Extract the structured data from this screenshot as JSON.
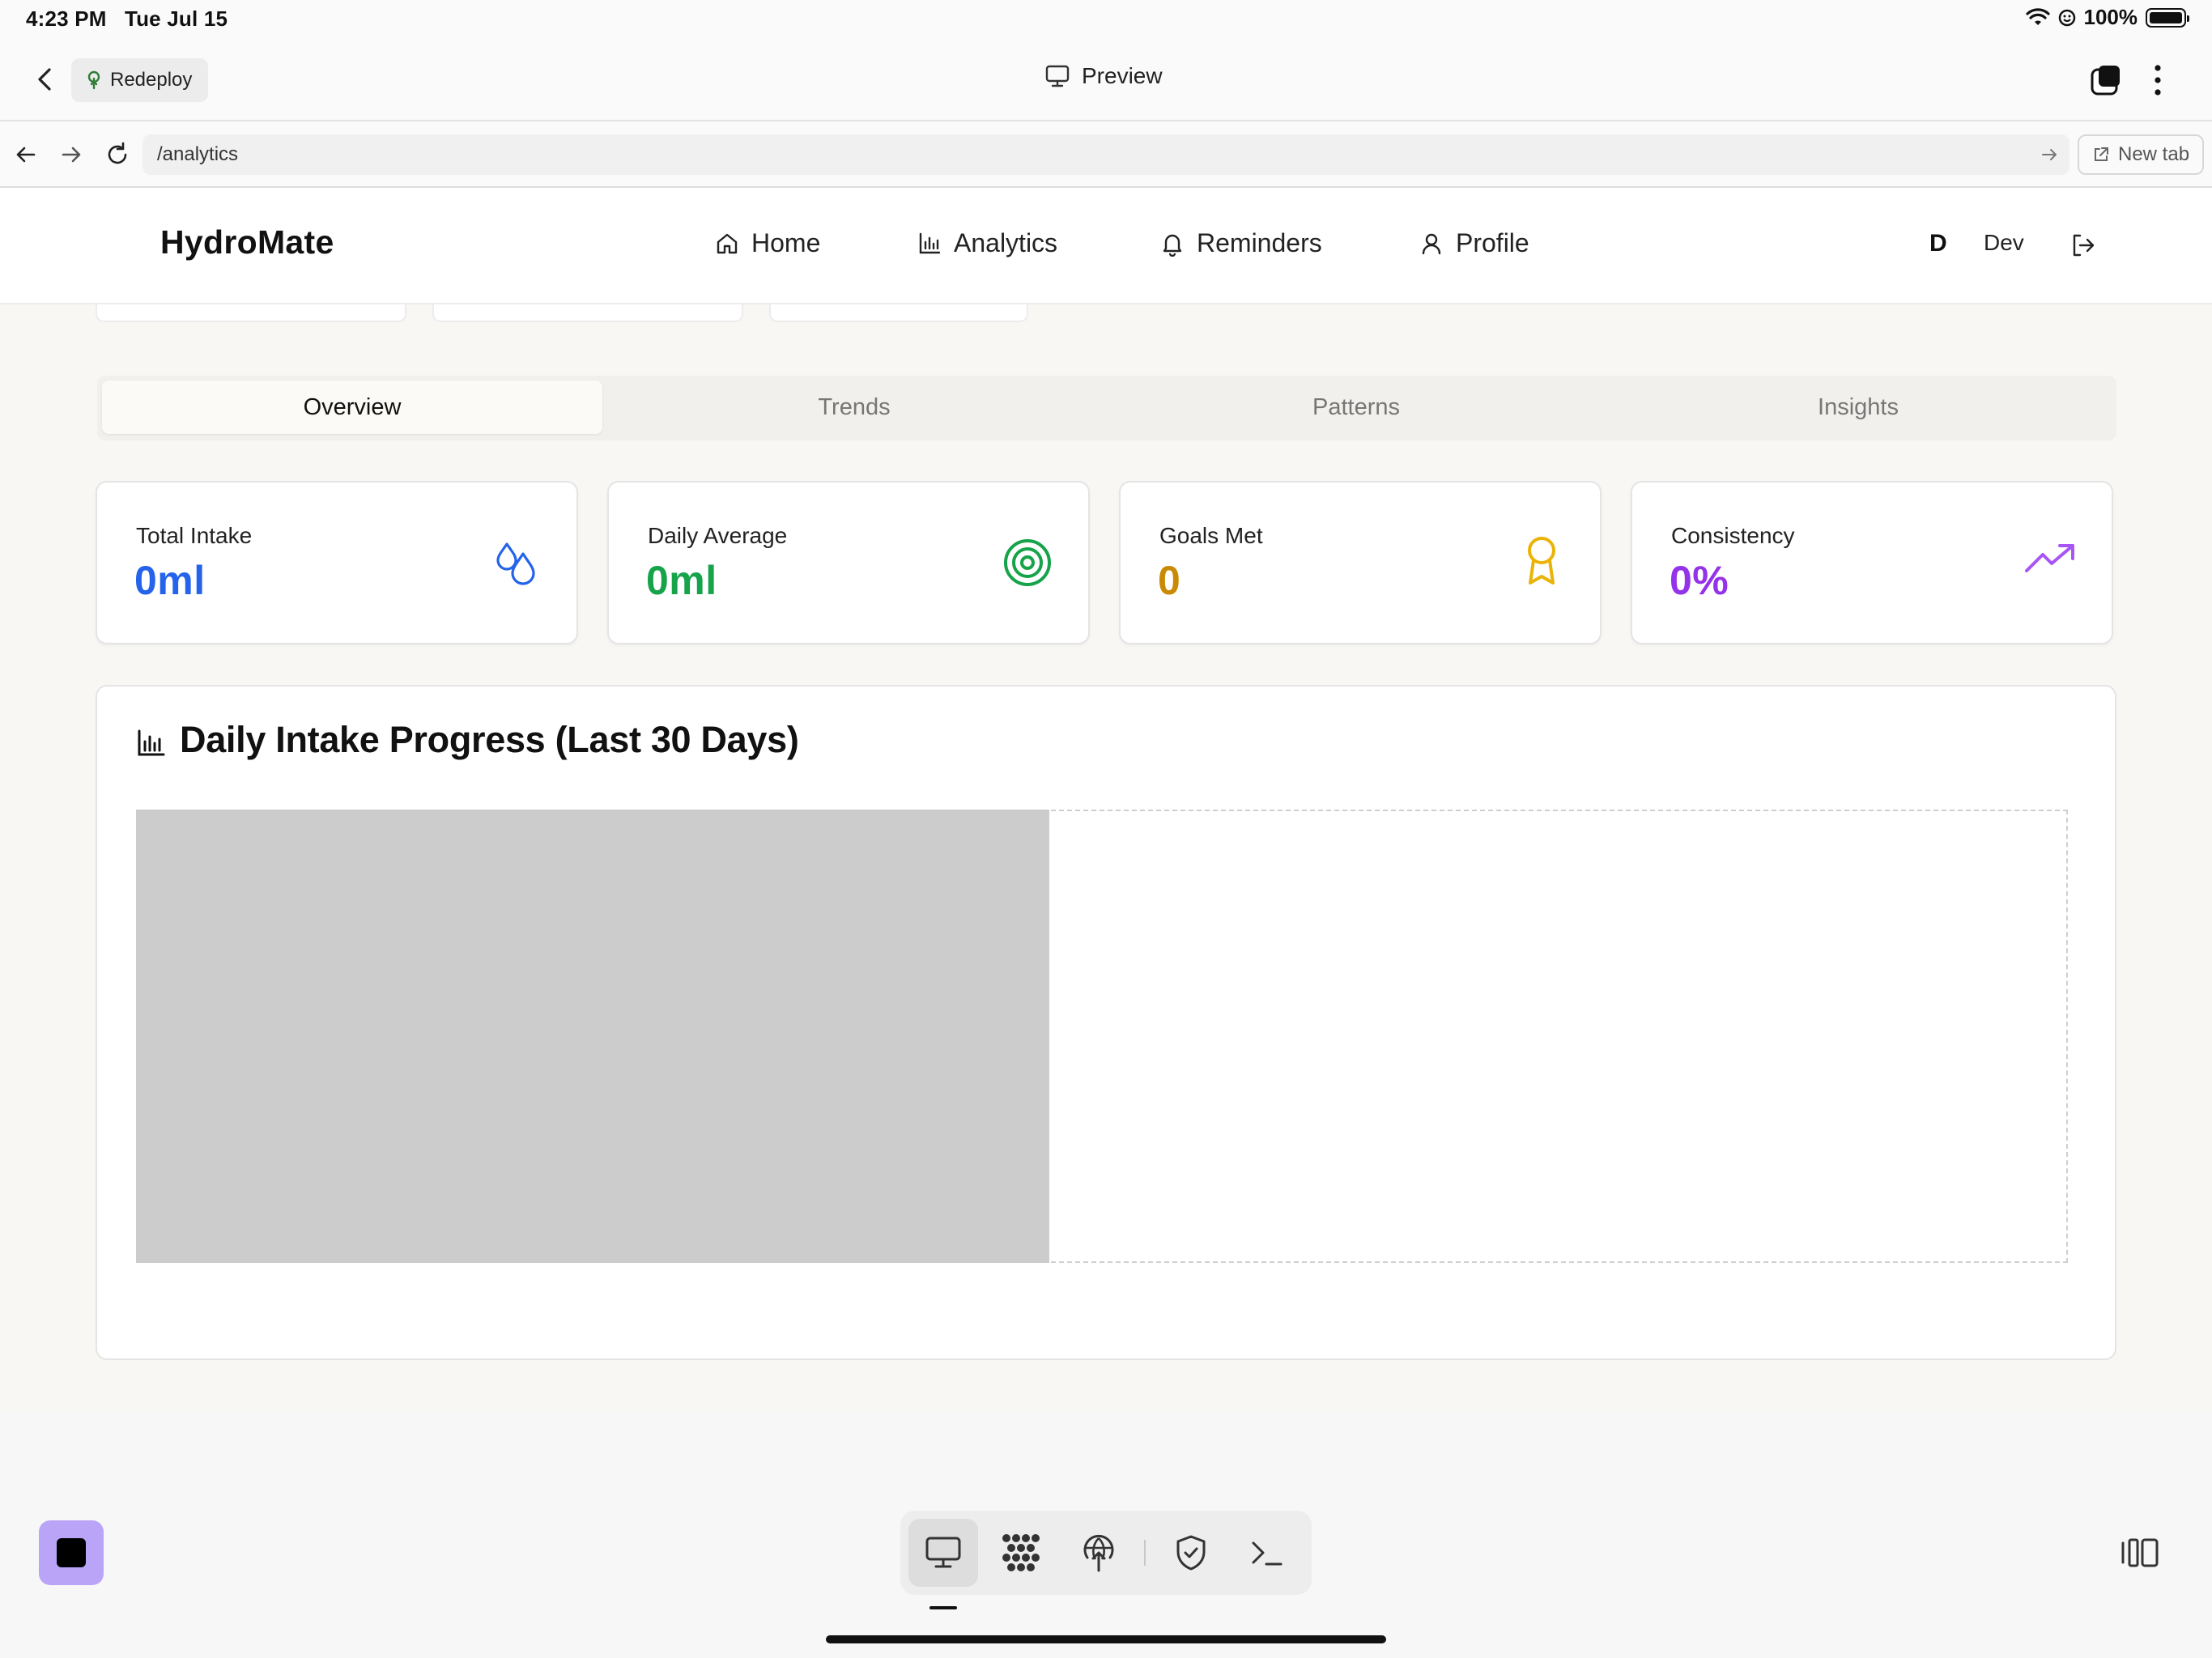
{
  "status_bar": {
    "time": "4:23 PM",
    "date": "Tue Jul 15",
    "battery": "100%"
  },
  "app_bar": {
    "redeploy_label": "Redeploy",
    "title": "Preview"
  },
  "url_bar": {
    "url": "/analytics",
    "new_tab_label": "New tab"
  },
  "site": {
    "brand": "HydroMate",
    "nav": [
      {
        "label": "Home",
        "icon": "home-icon"
      },
      {
        "label": "Analytics",
        "icon": "bar-chart-icon"
      },
      {
        "label": "Reminders",
        "icon": "bell-icon"
      },
      {
        "label": "Profile",
        "icon": "user-icon"
      }
    ],
    "user": {
      "initial": "D",
      "name": "Dev"
    }
  },
  "tabs": [
    "Overview",
    "Trends",
    "Patterns",
    "Insights"
  ],
  "active_tab": "Overview",
  "stats": [
    {
      "label": "Total Intake",
      "value": "0ml",
      "color": "#2563eb",
      "icon": "droplets-icon"
    },
    {
      "label": "Daily Average",
      "value": "0ml",
      "color": "#16a34a",
      "icon": "target-icon"
    },
    {
      "label": "Goals Met",
      "value": "0",
      "color": "#ca8a04",
      "icon": "award-icon"
    },
    {
      "label": "Consistency",
      "value": "0%",
      "color": "#9333ea",
      "icon": "trending-up-icon"
    }
  ],
  "chart_section": {
    "title": "Daily Intake Progress (Last 30 Days)"
  },
  "colors": {
    "accent_purple": "#b9a4f7",
    "page_bg": "#f8f7f4"
  }
}
